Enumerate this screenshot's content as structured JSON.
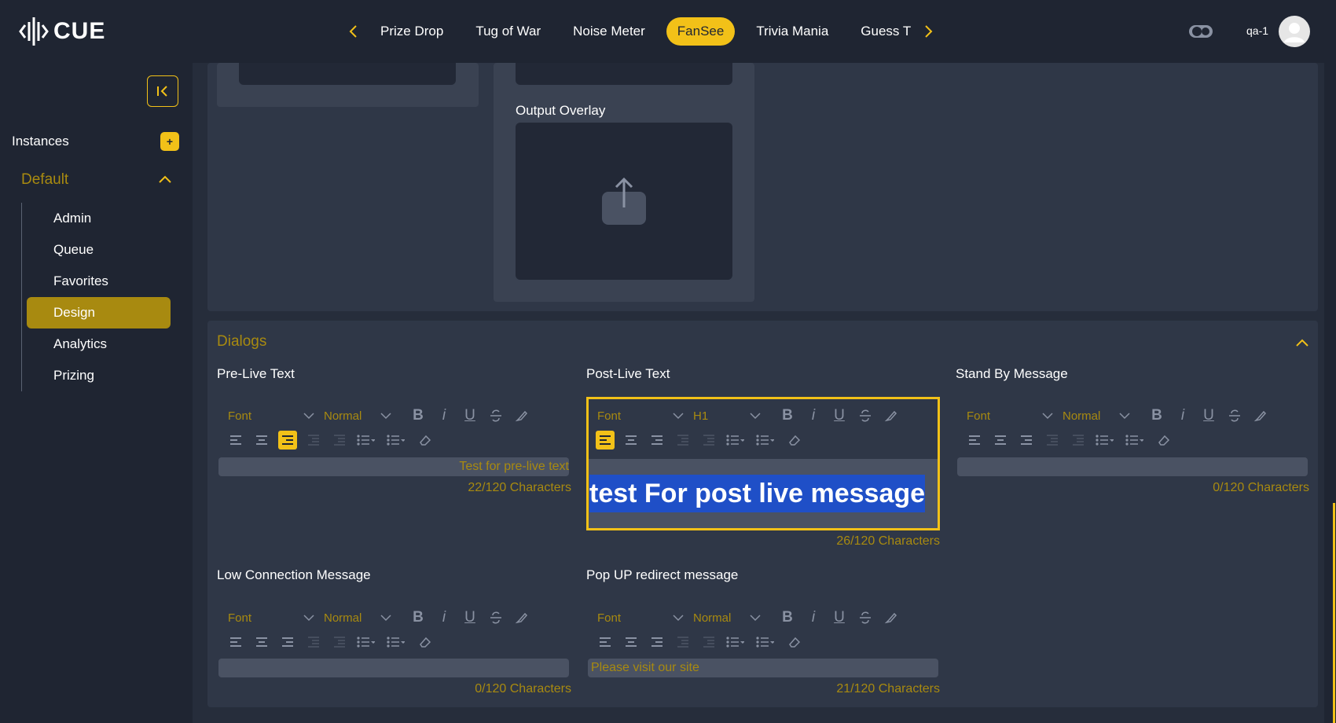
{
  "brand": {
    "name": "CUE"
  },
  "nav": {
    "tabs": [
      "Prize Drop",
      "Tug of War",
      "Noise Meter",
      "FanSee",
      "Trivia Mania",
      "Guess T"
    ],
    "active_tab": "FanSee"
  },
  "user": {
    "name": "qa-1"
  },
  "sidebar": {
    "instances_label": "Instances",
    "add_label": "+",
    "group_label": "Default",
    "items": [
      "Admin",
      "Queue",
      "Favorites",
      "Design",
      "Analytics",
      "Prizing"
    ],
    "active_item": "Design"
  },
  "upload": {
    "output_overlay_label": "Output Overlay"
  },
  "dialogs": {
    "title": "Dialogs",
    "editors": [
      {
        "label": "Pre-Live Text",
        "font": "Font",
        "size": "Normal",
        "content": "Test for pre-live text",
        "counter": "22/120 Characters"
      },
      {
        "label": "Post-Live Text",
        "font": "Font",
        "size": "H1",
        "content": "test For post live message",
        "counter": "26/120 Characters"
      },
      {
        "label": "Stand By Message",
        "font": "Font",
        "size": "Normal",
        "content": "",
        "counter": "0/120 Characters"
      },
      {
        "label": "Low Connection Message",
        "font": "Font",
        "size": "Normal",
        "content": "",
        "counter": "0/120 Characters"
      },
      {
        "label": "Pop UP redirect message",
        "font": "Font",
        "size": "Normal",
        "content": "Please visit our site",
        "counter": "21/120 Characters"
      }
    ]
  },
  "toolbar": {
    "bold": "B",
    "italic": "i",
    "underline": "U",
    "icons": [
      "align-left-icon",
      "align-center-icon",
      "align-right-icon",
      "indent-decrease-icon",
      "indent-increase-icon",
      "ordered-list-icon",
      "bullet-list-icon",
      "clear-format-icon"
    ]
  },
  "colors": {
    "accent": "#f2c118",
    "accent_dark": "#a88a10",
    "background": "#1f2532",
    "panel": "#2f3747",
    "selection": "#1f4fc7"
  }
}
